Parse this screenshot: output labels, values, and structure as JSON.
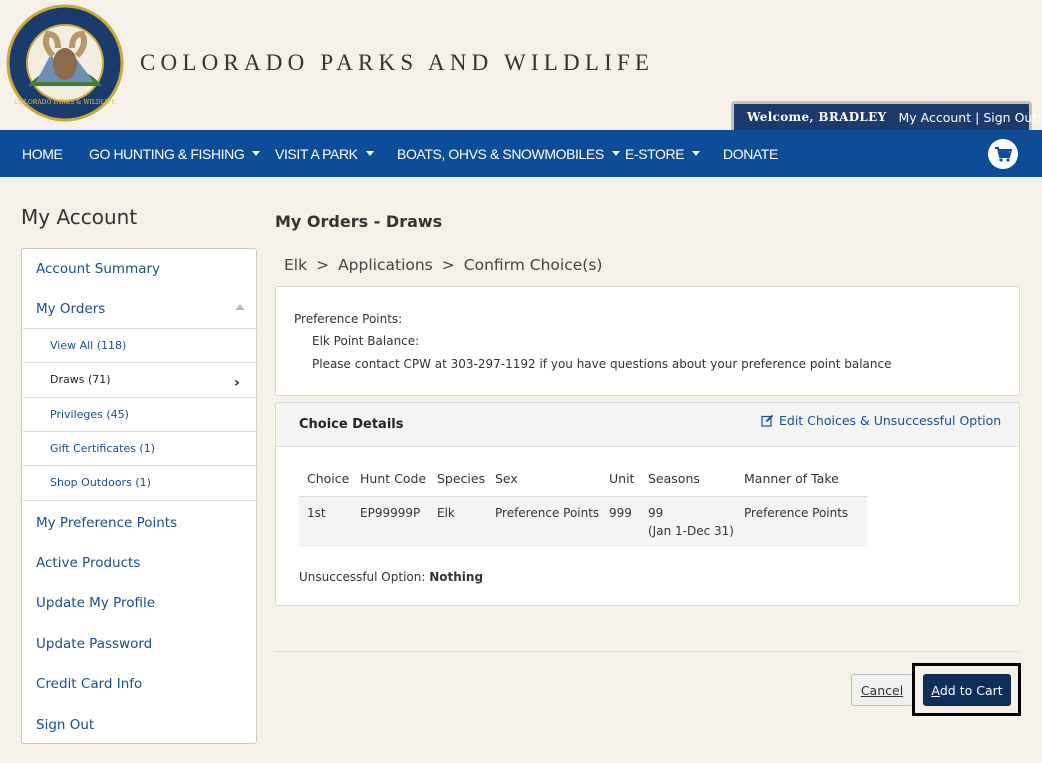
{
  "header": {
    "logo_text": "COLORADO PARKS & WILDLIFE",
    "site_title": "COLORADO PARKS AND WILDLIFE",
    "welcome_label": "Welcome, BRADLEY",
    "my_account_link": "My Account",
    "separator": "|",
    "sign_out_link": "Sign Out"
  },
  "nav": {
    "items": [
      {
        "label": "HOME"
      },
      {
        "label": "GO HUNTING & FISHING"
      },
      {
        "label": "VISIT A PARK"
      },
      {
        "label": "BOATS, OHVS & SNOWMOBILES"
      },
      {
        "label": "E-STORE"
      },
      {
        "label": "DONATE"
      }
    ],
    "cart_icon": "shopping-cart-icon"
  },
  "sidebar": {
    "title": "My Account",
    "account_summary": "Account Summary",
    "my_orders": "My Orders",
    "orders_sub": [
      {
        "label": "View All (118)"
      },
      {
        "label": "Draws (71)"
      },
      {
        "label": "Privileges (45)"
      },
      {
        "label": "Gift Certificates (1)"
      },
      {
        "label": "Shop Outdoors (1)"
      }
    ],
    "links": [
      {
        "label": "My Preference Points"
      },
      {
        "label": "Active Products"
      },
      {
        "label": "Update My Profile"
      },
      {
        "label": "Update Password"
      },
      {
        "label": "Credit Card Info"
      },
      {
        "label": "Sign Out"
      }
    ]
  },
  "main": {
    "title": "My Orders - Draws",
    "breadcrumb": [
      {
        "label": "Elk"
      },
      {
        "label": "Applications"
      },
      {
        "label": "Confirm Choice(s)"
      }
    ],
    "breadcrumb_sep": ">",
    "preference": {
      "label": "Preference Points:",
      "balance_label": "Elk Point Balance:",
      "contact_text": "Please contact CPW at 303-297-1192 if you have questions about your preference point balance"
    },
    "choice": {
      "title": "Choice Details",
      "edit_link": "Edit Choices & Unsuccessful Option",
      "columns": [
        "Choice",
        "Hunt Code",
        "Species",
        "Sex",
        "Unit",
        "Seasons",
        "Manner of Take"
      ],
      "row": {
        "choice": "1st",
        "hunt_code": "EP99999P",
        "species": "Elk",
        "sex": "Preference Points",
        "unit": "999",
        "season_code": "99",
        "season_dates": "(Jan 1-Dec 31)",
        "manner": "Preference Points"
      },
      "unsuccessful_label": "Unsuccessful Option:",
      "unsuccessful_value": "Nothing"
    },
    "buttons": {
      "cancel_first": "C",
      "cancel_rest": "ancel",
      "add_first": "A",
      "add_rest": "dd to Cart"
    }
  },
  "colors": {
    "nav_bg": "#0f4c97",
    "welcome_bg": "#1a3b6b",
    "link": "#1a4f8a",
    "primary_button": "#0e2f59",
    "page_bg": "#f5f0e8"
  }
}
